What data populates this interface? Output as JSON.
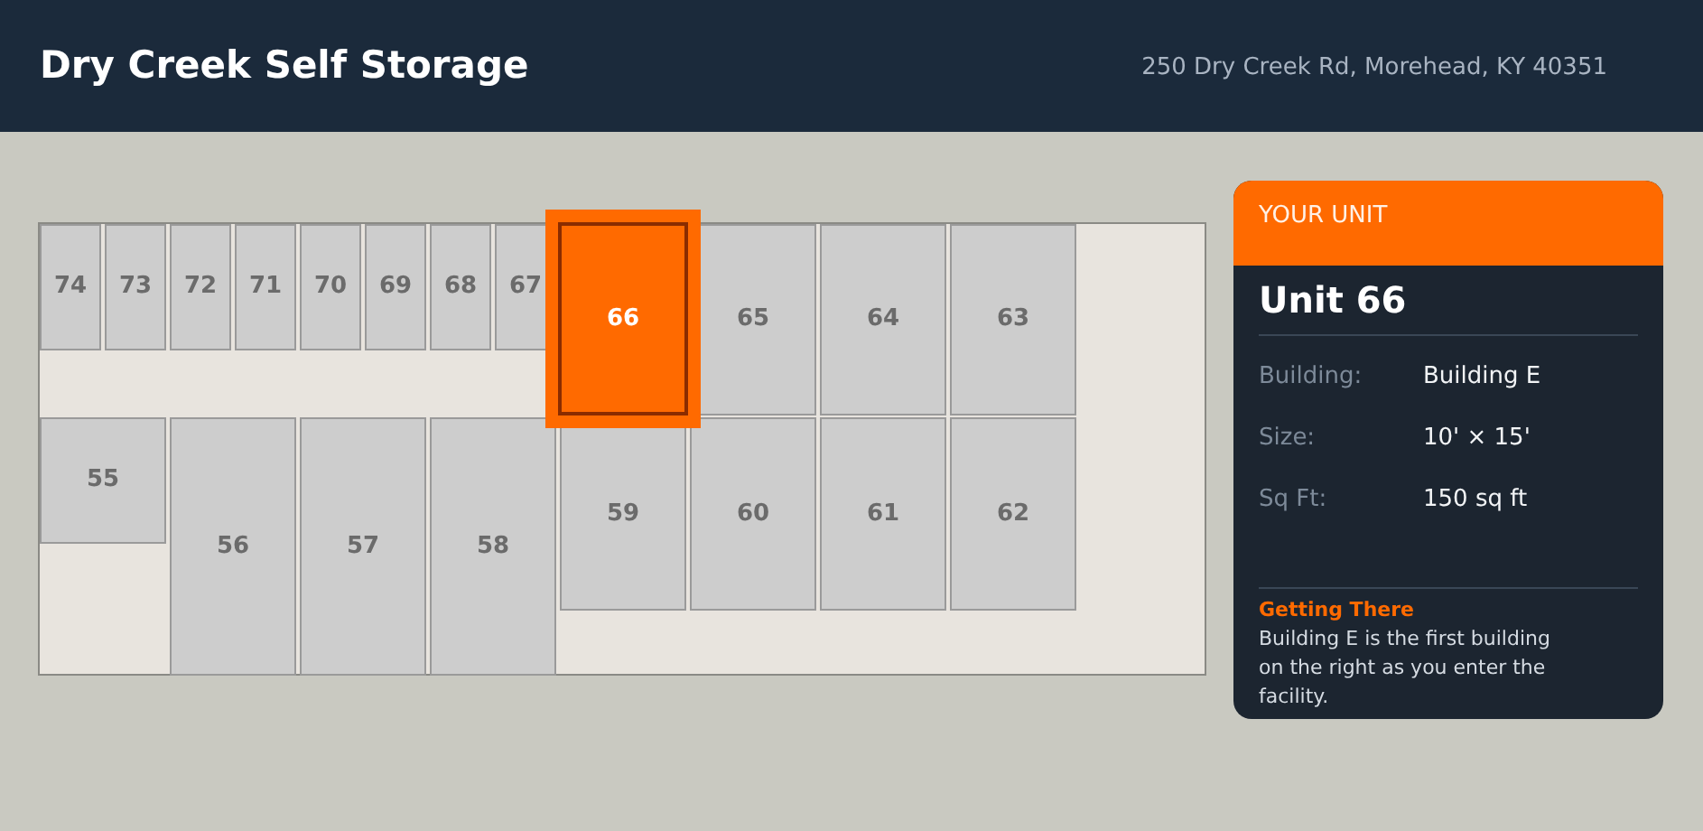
{
  "header": {
    "title": "Dry Creek Self Storage",
    "address": "250 Dry Creek Rd, Morehead, KY 40351"
  },
  "map": {
    "units": [
      {
        "number": "74",
        "selected": false
      },
      {
        "number": "73",
        "selected": false
      },
      {
        "number": "72",
        "selected": false
      },
      {
        "number": "71",
        "selected": false
      },
      {
        "number": "70",
        "selected": false
      },
      {
        "number": "69",
        "selected": false
      },
      {
        "number": "68",
        "selected": false
      },
      {
        "number": "67",
        "selected": false
      },
      {
        "number": "66",
        "selected": true
      },
      {
        "number": "65",
        "selected": false
      },
      {
        "number": "64",
        "selected": false
      },
      {
        "number": "63",
        "selected": false
      },
      {
        "number": "55",
        "selected": false
      },
      {
        "number": "56",
        "selected": false
      },
      {
        "number": "57",
        "selected": false
      },
      {
        "number": "58",
        "selected": false
      },
      {
        "number": "59",
        "selected": false
      },
      {
        "number": "60",
        "selected": false
      },
      {
        "number": "61",
        "selected": false
      },
      {
        "number": "62",
        "selected": false
      }
    ]
  },
  "unit_card": {
    "heading": "YOUR UNIT",
    "title": "Unit 66",
    "details": [
      {
        "label": "Building:",
        "value": "Building E"
      },
      {
        "label": "Size:",
        "value": "10' × 15'"
      },
      {
        "label": "Sq Ft:",
        "value": "150 sq ft"
      }
    ],
    "directions": {
      "title": "Getting There",
      "text": "Building E is the first building on the right as you enter the facility."
    }
  }
}
